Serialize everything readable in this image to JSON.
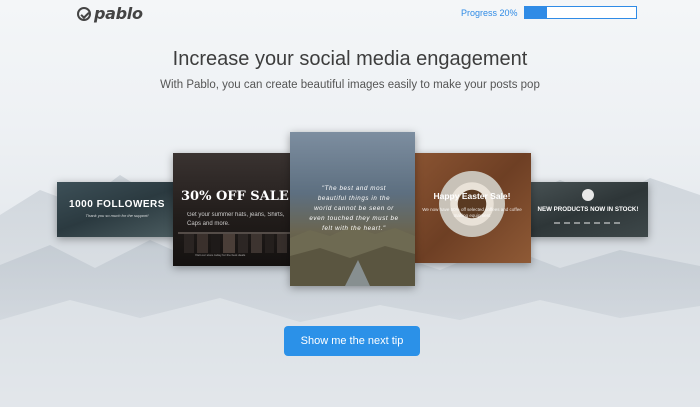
{
  "app": {
    "logo_text": "pablo",
    "logo_icon": "checkmark-circle-icon"
  },
  "progress": {
    "label": "Progress 20%",
    "percent": 20,
    "color": "#2f8be6"
  },
  "hero": {
    "headline": "Increase your social media engagement",
    "subline": "With Pablo, you can create beautiful images easily to make your posts pop"
  },
  "cards": {
    "followers": {
      "title": "1000 FOLLOWERS",
      "subtitle": "Thank you so much for the support!"
    },
    "sale": {
      "title": "30% OFF SALE",
      "subtitle": "Get your summer hats, jeans, Shirts, Caps and more.",
      "small": "Visit our store today for the best deals"
    },
    "quote": {
      "text": "\"The best and most beautiful things in the world cannot be seen or even touched they must be felt with the heart.\""
    },
    "easter": {
      "title": "Happy Easter Sale!",
      "subtitle": "We now have 50% off selected coffees and coffee making equipment"
    },
    "products": {
      "title": "NEW PRODUCTS NOW IN STOCK!"
    }
  },
  "cta": {
    "label": "Show me the next tip"
  },
  "colors": {
    "accent": "#2b91e8",
    "headline": "#3d3d3d"
  }
}
